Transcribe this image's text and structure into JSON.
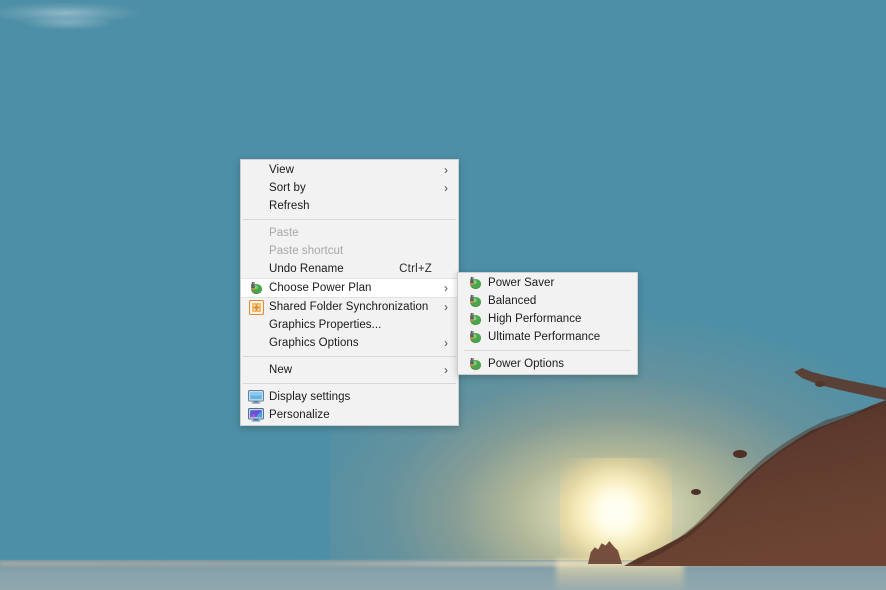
{
  "desktop": {
    "wallpaper_description": "Sunset over the sea with a dark headland silhouette on the right",
    "colors": {
      "sky_top": "#3c7e9b",
      "sky_mid": "#74b3b8",
      "sky_horizon": "#f0a06a",
      "sun_core": "#fffff8",
      "sea": "#86a1aa",
      "headland": "#5e3a2e"
    }
  },
  "context_menu": {
    "name": "desktop-context-menu",
    "background": "#f2f2f2",
    "border": "#cfcfcf",
    "items": [
      {
        "label": "View",
        "icon": "",
        "submenu": true,
        "disabled": false,
        "accel": "",
        "highlight": false
      },
      {
        "label": "Sort by",
        "icon": "",
        "submenu": true,
        "disabled": false,
        "accel": "",
        "highlight": false
      },
      {
        "label": "Refresh",
        "icon": "",
        "submenu": false,
        "disabled": false,
        "accel": "",
        "highlight": false
      },
      {
        "separator": true
      },
      {
        "label": "Paste",
        "icon": "",
        "submenu": false,
        "disabled": true,
        "accel": "",
        "highlight": false
      },
      {
        "label": "Paste shortcut",
        "icon": "",
        "submenu": false,
        "disabled": true,
        "accel": "",
        "highlight": false
      },
      {
        "label": "Undo Rename",
        "icon": "",
        "submenu": false,
        "disabled": false,
        "accel": "Ctrl+Z",
        "highlight": false
      },
      {
        "label": "Choose Power Plan",
        "icon": "power-plug-icon",
        "submenu": true,
        "disabled": false,
        "accel": "",
        "highlight": true
      },
      {
        "label": "Shared Folder Synchronization",
        "icon": "shared-folder-icon",
        "submenu": true,
        "disabled": false,
        "accel": "",
        "highlight": false
      },
      {
        "label": "Graphics Properties...",
        "icon": "",
        "submenu": false,
        "disabled": false,
        "accel": "",
        "highlight": false
      },
      {
        "label": "Graphics Options",
        "icon": "",
        "submenu": true,
        "disabled": false,
        "accel": "",
        "highlight": false
      },
      {
        "separator": true
      },
      {
        "label": "New",
        "icon": "",
        "submenu": true,
        "disabled": false,
        "accel": "",
        "highlight": false
      },
      {
        "separator": true
      },
      {
        "label": "Display settings",
        "icon": "display-monitor-icon",
        "submenu": false,
        "disabled": false,
        "accel": "",
        "highlight": false
      },
      {
        "label": "Personalize",
        "icon": "personalize-monitor-icon",
        "submenu": false,
        "disabled": false,
        "accel": "",
        "highlight": false
      }
    ]
  },
  "submenu": {
    "name": "choose-power-plan-submenu",
    "parent_item": "Choose Power Plan",
    "items": [
      {
        "label": "Power Saver",
        "icon": "power-plug-icon",
        "separator_after": false
      },
      {
        "label": "Balanced",
        "icon": "power-plug-icon",
        "separator_after": false
      },
      {
        "label": "High Performance",
        "icon": "power-plug-icon",
        "separator_after": false
      },
      {
        "label": "Ultimate Performance",
        "icon": "power-plug-icon",
        "separator_after": true
      },
      {
        "label": "Power Options",
        "icon": "power-plug-icon",
        "separator_after": false
      }
    ]
  },
  "glyphs": {
    "submenu_chevron": "›"
  }
}
